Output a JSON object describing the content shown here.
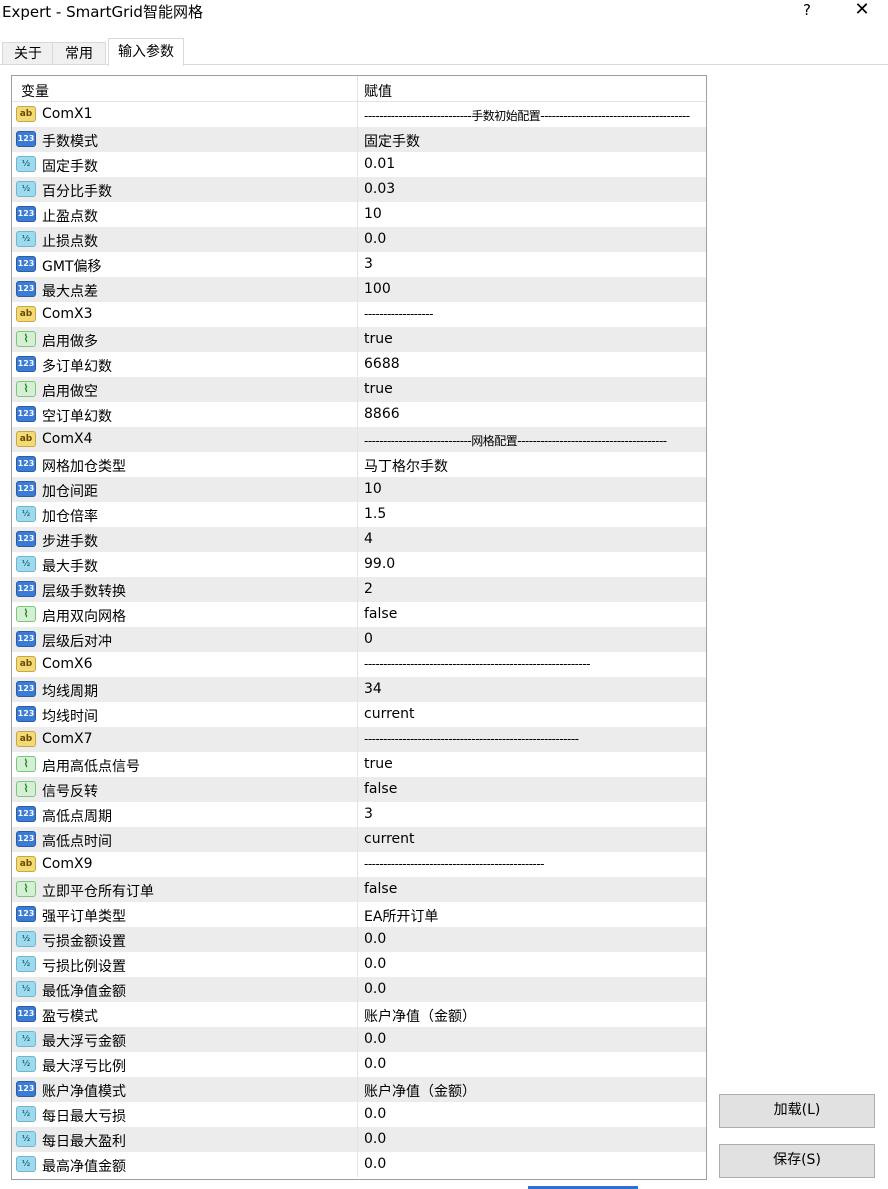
{
  "window": {
    "title": "Expert - SmartGrid智能网格",
    "help": "?",
    "close": "✕"
  },
  "tabs": [
    {
      "label": "关于"
    },
    {
      "label": "常用"
    },
    {
      "label": "输入参数"
    }
  ],
  "grid": {
    "headers": {
      "variable": "变量",
      "value": "赋值"
    },
    "rows": [
      {
        "type": "str",
        "name": "ComX1",
        "value": "----------------------------手数初始配置---------------------------------------"
      },
      {
        "type": "int",
        "name": "手数模式",
        "value": "固定手数"
      },
      {
        "type": "dbl",
        "name": "固定手数",
        "value": "0.01"
      },
      {
        "type": "dbl",
        "name": "百分比手数",
        "value": "0.03"
      },
      {
        "type": "int",
        "name": "止盈点数",
        "value": "10"
      },
      {
        "type": "dbl",
        "name": "止损点数",
        "value": "0.0"
      },
      {
        "type": "int",
        "name": "GMT偏移",
        "value": "3"
      },
      {
        "type": "int",
        "name": "最大点差",
        "value": "100"
      },
      {
        "type": "str",
        "name": "ComX3",
        "value": "------------------"
      },
      {
        "type": "bool",
        "name": "启用做多",
        "value": "true"
      },
      {
        "type": "int",
        "name": "多订单幻数",
        "value": "6688"
      },
      {
        "type": "bool",
        "name": "启用做空",
        "value": "true"
      },
      {
        "type": "int",
        "name": "空订单幻数",
        "value": "8866"
      },
      {
        "type": "str",
        "name": "ComX4",
        "value": "----------------------------网格配置---------------------------------------"
      },
      {
        "type": "int",
        "name": "网格加仓类型",
        "value": "马丁格尔手数"
      },
      {
        "type": "int",
        "name": "加仓间距",
        "value": "10"
      },
      {
        "type": "dbl",
        "name": "加仓倍率",
        "value": "1.5"
      },
      {
        "type": "int",
        "name": "步进手数",
        "value": "4"
      },
      {
        "type": "dbl",
        "name": "最大手数",
        "value": "99.0"
      },
      {
        "type": "int",
        "name": "层级手数转换",
        "value": "2"
      },
      {
        "type": "bool",
        "name": "启用双向网格",
        "value": "false"
      },
      {
        "type": "int",
        "name": "层级后对冲",
        "value": "0"
      },
      {
        "type": "str",
        "name": "ComX6",
        "value": "-----------------------------------------------------------"
      },
      {
        "type": "int",
        "name": "均线周期",
        "value": "34"
      },
      {
        "type": "int",
        "name": "均线时间",
        "value": "current"
      },
      {
        "type": "str",
        "name": "ComX7",
        "value": "--------------------------------------------------------"
      },
      {
        "type": "bool",
        "name": "启用高低点信号",
        "value": "true"
      },
      {
        "type": "bool",
        "name": "信号反转",
        "value": "false"
      },
      {
        "type": "int",
        "name": "高低点周期",
        "value": "3"
      },
      {
        "type": "int",
        "name": "高低点时间",
        "value": "current"
      },
      {
        "type": "str",
        "name": "ComX9",
        "value": "-----------------------------------------------"
      },
      {
        "type": "bool",
        "name": "立即平仓所有订单",
        "value": "false"
      },
      {
        "type": "int",
        "name": "强平订单类型",
        "value": "EA所开订单"
      },
      {
        "type": "dbl",
        "name": "亏损金额设置",
        "value": "0.0"
      },
      {
        "type": "dbl",
        "name": "亏损比例设置",
        "value": "0.0"
      },
      {
        "type": "dbl",
        "name": "最低净值金额",
        "value": "0.0"
      },
      {
        "type": "int",
        "name": "盈亏模式",
        "value": "账户净值（金额）"
      },
      {
        "type": "dbl",
        "name": "最大浮亏金额",
        "value": "0.0"
      },
      {
        "type": "dbl",
        "name": "最大浮亏比例",
        "value": "0.0"
      },
      {
        "type": "int",
        "name": "账户净值模式",
        "value": "账户净值（金额）"
      },
      {
        "type": "dbl",
        "name": "每日最大亏损",
        "value": "0.0"
      },
      {
        "type": "dbl",
        "name": "每日最大盈利",
        "value": "0.0"
      },
      {
        "type": "dbl",
        "name": "最高净值金额",
        "value": "0.0"
      }
    ]
  },
  "icons": {
    "str": {
      "glyph": "ab",
      "name": "string-type-icon"
    },
    "int": {
      "glyph": "123",
      "name": "integer-type-icon"
    },
    "dbl": {
      "glyph": "½",
      "name": "double-type-icon"
    },
    "bool": {
      "glyph": "⌇",
      "name": "boolean-type-icon"
    }
  },
  "buttons": {
    "load": "加载(L)",
    "save": "保存(S)"
  }
}
